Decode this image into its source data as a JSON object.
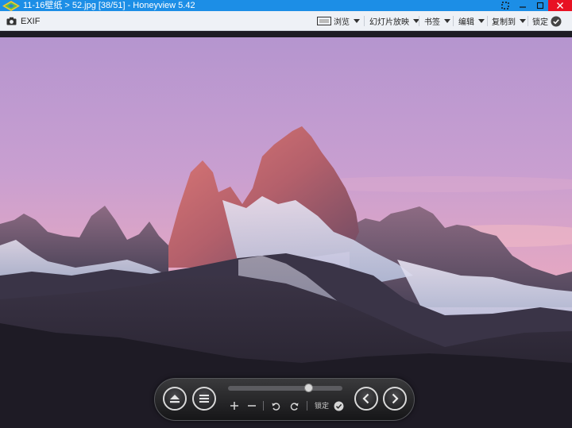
{
  "window": {
    "title": "11-16壁纸 > 52.jpg [38/51] - Honeyview 5.42"
  },
  "toolbar": {
    "exif_label": "EXIF",
    "items": [
      {
        "label": "浏览",
        "icon": "browse-icon"
      },
      {
        "label": "幻灯片放映"
      },
      {
        "label": "书签"
      },
      {
        "label": "编辑"
      },
      {
        "label": "复制到"
      },
      {
        "label": "锁定",
        "icon": "check-circle-icon"
      }
    ]
  },
  "viewer": {
    "image_subject": "mountain-sunset-photo",
    "slider_position": 0.7
  },
  "controls": {
    "lock_label": "锁定",
    "icons": [
      "eject-icon",
      "menu-icon",
      "zoom-in-icon",
      "zoom-out-icon",
      "rotate-left-icon",
      "rotate-right-icon",
      "check-circle-icon",
      "previous-icon",
      "next-icon"
    ]
  },
  "colors": {
    "titlebar": "#1c8ee6",
    "close_button": "#e81123",
    "toolbar_bg": "#eef1f6"
  }
}
